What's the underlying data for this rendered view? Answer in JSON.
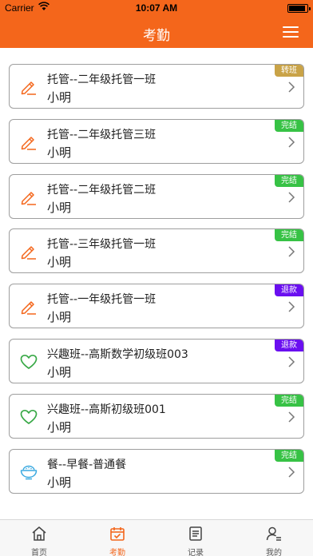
{
  "status_bar": {
    "carrier": "Carrier",
    "time": "10:07 AM",
    "battery_level": 0.9
  },
  "nav_bar": {
    "title": "考勤",
    "menu_icon": "hamburger-menu-icon"
  },
  "colors": {
    "brand": "#f4661b",
    "badge_transfer": "#c9a347",
    "badge_complete": "#37c245",
    "badge_refund": "#6a0ff0",
    "pencil_icon": "#f4661b",
    "heart_icon": "#37a845",
    "bowl_icon": "#3aa9e0"
  },
  "cards": [
    {
      "course": "托管--二年级托管一班",
      "student": "小明",
      "badge": "转班",
      "badge_type": "transfer",
      "icon": "pencil-icon"
    },
    {
      "course": "托管--二年级托管三班",
      "student": "小明",
      "badge": "完结",
      "badge_type": "complete",
      "icon": "pencil-icon"
    },
    {
      "course": "托管--二年级托管二班",
      "student": "小明",
      "badge": "完结",
      "badge_type": "complete",
      "icon": "pencil-icon"
    },
    {
      "course": "托管--三年级托管一班",
      "student": "小明",
      "badge": "完结",
      "badge_type": "complete",
      "icon": "pencil-icon"
    },
    {
      "course": "托管--一年级托管一班",
      "student": "小明",
      "badge": "退款",
      "badge_type": "refund",
      "icon": "pencil-icon"
    },
    {
      "course": "兴趣班--高斯数学初级班003",
      "student": "小明",
      "badge": "退款",
      "badge_type": "refund",
      "icon": "heart-icon"
    },
    {
      "course": "兴趣班--高斯初级班001",
      "student": "小明",
      "badge": "完结",
      "badge_type": "complete",
      "icon": "heart-icon"
    },
    {
      "course": "餐--早餐-普通餐",
      "student": "小明",
      "badge": "完结",
      "badge_type": "complete",
      "icon": "bowl-icon"
    }
  ],
  "tab_bar": {
    "tabs": [
      {
        "label": "首页",
        "icon": "home-icon",
        "active": false
      },
      {
        "label": "考勤",
        "icon": "calendar-check-icon",
        "active": true
      },
      {
        "label": "记录",
        "icon": "document-icon",
        "active": false
      },
      {
        "label": "我的",
        "icon": "user-icon",
        "active": false
      }
    ]
  }
}
